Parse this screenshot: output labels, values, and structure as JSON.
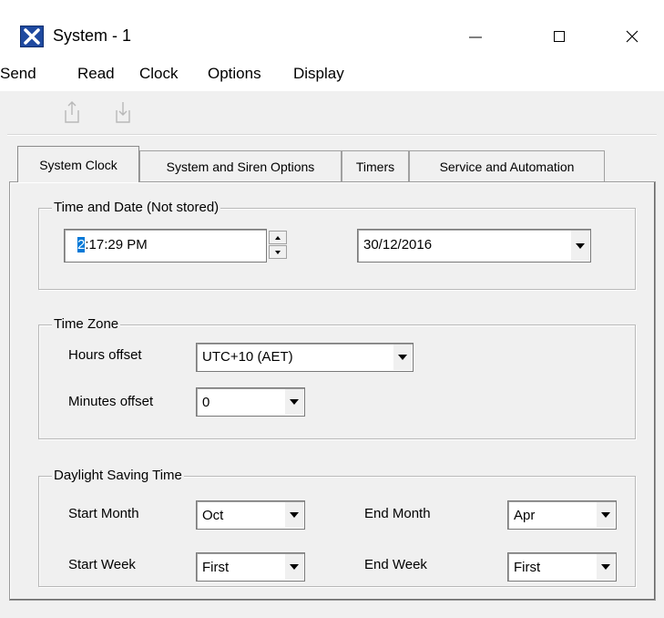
{
  "window": {
    "title": "System - 1",
    "controls": {
      "minimize_glyph": "—",
      "maximize_glyph": "☐",
      "close_glyph": "✕"
    }
  },
  "menu": {
    "items": [
      "Send",
      "Read",
      "Clock",
      "Options",
      "Display"
    ]
  },
  "toolbar": {
    "icons": [
      "upload-icon",
      "download-icon"
    ]
  },
  "tabs": [
    {
      "label": "System Clock",
      "active": true
    },
    {
      "label": "System and Siren Options",
      "active": false
    },
    {
      "label": "Timers",
      "active": false
    },
    {
      "label": "Service and Automation",
      "active": false
    }
  ],
  "time_date": {
    "group_label": "Time and Date (Not stored)",
    "time_selected": "2",
    "time_rest": ":17:29 PM",
    "date_value": "30/12/2016"
  },
  "time_zone": {
    "group_label": "Time Zone",
    "hours_label": "Hours offset",
    "hours_value": "UTC+10 (AET)",
    "minutes_label": "Minutes offset",
    "minutes_value": "0"
  },
  "dst": {
    "group_label": "Daylight Saving Time",
    "start_month_label": "Start Month",
    "start_month_value": "Oct",
    "end_month_label": "End Month",
    "end_month_value": "Apr",
    "start_week_label": "Start Week",
    "start_week_value": "First",
    "end_week_label": "End Week",
    "end_week_value": "First"
  },
  "colors": {
    "selection": "#0078d7",
    "window_bg": "#f0f0f0",
    "icon_blue": "#1f4aa0"
  }
}
